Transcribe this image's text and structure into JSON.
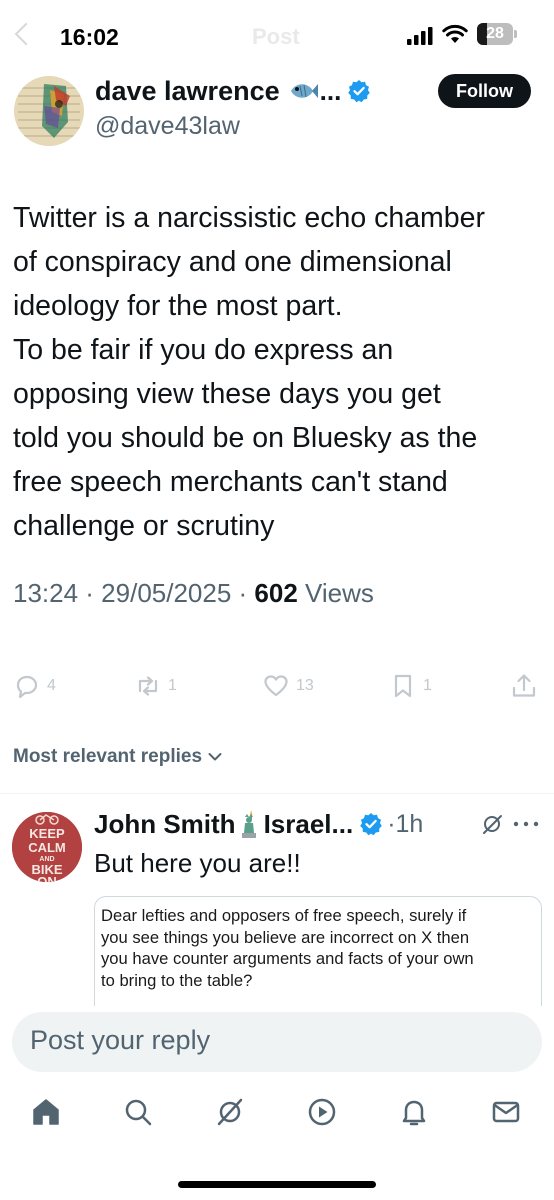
{
  "status_bar": {
    "time": "16:02",
    "ghost_title": "Post",
    "battery_level": "28",
    "battery_fraction": 0.28
  },
  "tweet": {
    "author_name": "dave lawrence",
    "author_emoji": "fish-icon",
    "author_name_ellipsis": "...",
    "author_handle": "@dave43law",
    "follow_label": "Follow",
    "text_lines": [
      "Twitter is a narcissistic echo chamber",
      "of conspiracy and one dimensional",
      "ideology for the most part.",
      "To be fair if you do express an",
      "opposing view these days you get",
      "told you should be on Bluesky as the",
      "free speech merchants can't stand",
      "challenge or scrutiny"
    ],
    "timestamp": "13:24 · 29/05/2025 · ",
    "views_count": "602",
    "views_label": " Views",
    "actions": {
      "replies": "4",
      "reposts": "1",
      "likes": "13",
      "bookmarks": "1"
    }
  },
  "sort_label": "Most relevant replies",
  "reply": {
    "name": "John Smith",
    "name_emoji": "statue-of-liberty-icon",
    "name_suffix": "Israel...",
    "time": "·1h",
    "text": "But here you are!!",
    "avatar_text": [
      "KEEP",
      "CALM",
      "AND",
      "BIKE",
      "ON"
    ],
    "quoted_lines": [
      "Dear lefties and opposers of free speech, surely if",
      "you see things you believe are incorrect on X then",
      "you have counter arguments and facts of your own",
      "to bring to the table?"
    ]
  },
  "reply_box": {
    "placeholder": "Post your reply"
  },
  "colors": {
    "accent": "#1d9bf0",
    "text_primary": "#0f1419",
    "text_secondary": "#536471"
  }
}
